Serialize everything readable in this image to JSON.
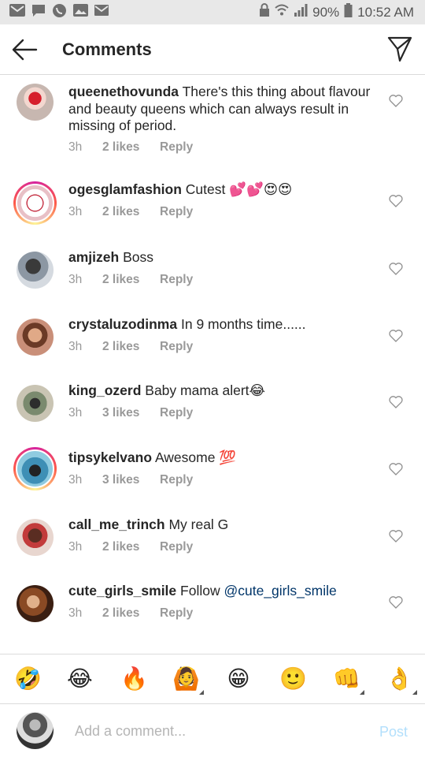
{
  "status_bar": {
    "battery": "90%",
    "time": "10:52 AM",
    "left_icons": [
      "gmail-icon",
      "message-icon",
      "whatsapp-icon",
      "gallery-icon",
      "email-icon"
    ],
    "right_icons": [
      "lock-icon",
      "wifi-icon",
      "signal-icon",
      "battery-icon"
    ]
  },
  "header": {
    "title": "Comments",
    "back_icon": "arrow-left-icon",
    "send_icon": "direct-send-icon"
  },
  "comments": [
    {
      "username": "queenethovunda",
      "text": "There's this thing about flavour and beauty queens which can always result in missing of period.",
      "time": "3h",
      "likes": "2 likes",
      "reply": "Reply"
    },
    {
      "username": "ogesglamfashion",
      "text": "Cutest 💕💕😍😍",
      "time": "3h",
      "likes": "2 likes",
      "reply": "Reply"
    },
    {
      "username": "amjizeh",
      "text": "Boss",
      "time": "3h",
      "likes": "2 likes",
      "reply": "Reply"
    },
    {
      "username": "crystaluzodinma",
      "text": "In 9 months time......",
      "time": "3h",
      "likes": "2 likes",
      "reply": "Reply"
    },
    {
      "username": "king_ozerd",
      "text": "Baby mama alert😂",
      "time": "3h",
      "likes": "3 likes",
      "reply": "Reply"
    },
    {
      "username": "tipsykelvano",
      "text": "Awesome 💯",
      "time": "3h",
      "likes": "3 likes",
      "reply": "Reply"
    },
    {
      "username": "call_me_trinch",
      "text": "My real G",
      "time": "3h",
      "likes": "2 likes",
      "reply": "Reply"
    },
    {
      "username": "cute_girls_smile",
      "text": "Follow",
      "mention": "@cute_girls_smile",
      "time": "3h",
      "likes": "2 likes",
      "reply": "Reply"
    }
  ],
  "emoji_bar": {
    "emojis": [
      "🤣",
      "😂",
      "🔥",
      "🙆",
      "😁",
      "🙂",
      "👊",
      "👌"
    ]
  },
  "composer": {
    "placeholder": "Add a comment...",
    "post_label": "Post"
  },
  "colors": {
    "accent": "#3897f0",
    "post_disabled": "#b2dffc",
    "meta_gray": "#999999",
    "mention": "#003569"
  }
}
